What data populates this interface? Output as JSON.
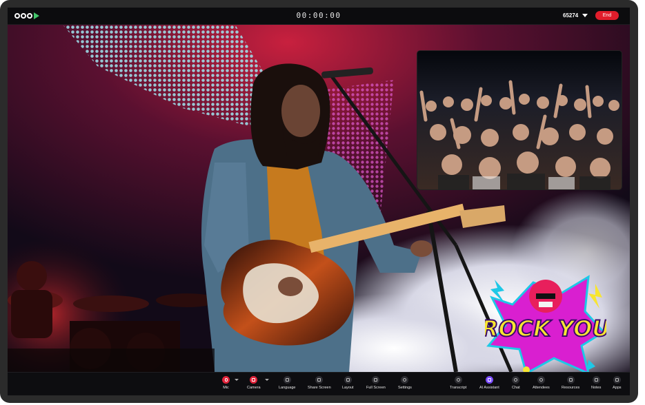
{
  "app": {
    "logo_text": "OOOK",
    "timer": "00:00:00",
    "room_id": "65274",
    "end_label": "End"
  },
  "sticker": {
    "text": "ROCK YOU"
  },
  "toolbar": {
    "mic": "Mic",
    "camera": "Camera",
    "language": "Language",
    "share_screen": "Share Screen",
    "layout": "Layout",
    "full_screen": "Full Screen",
    "settings": "Settings",
    "transcript": "Transcript",
    "ai_assistant": "AI Assistant",
    "chat": "Chat",
    "attendees": "Attendees",
    "resources": "Resources",
    "notes": "Notes",
    "apps": "Apps"
  },
  "colors": {
    "end": "#e11d2b",
    "mic_active": "#e0233a",
    "ai_accent": "#7b4bff",
    "logo_accent": "#43c56a",
    "sticker_yellow": "#f7e531",
    "sticker_magenta": "#d91fd0",
    "sticker_cyan": "#1ec8e6"
  },
  "icons": [
    "mic-icon",
    "camera-icon",
    "language-icon",
    "share-screen-icon",
    "layout-icon",
    "full-screen-icon",
    "settings-icon",
    "transcript-icon",
    "ai-assistant-icon",
    "chat-icon",
    "attendees-icon",
    "resources-icon",
    "notes-icon",
    "apps-icon",
    "chevron-down-icon"
  ]
}
